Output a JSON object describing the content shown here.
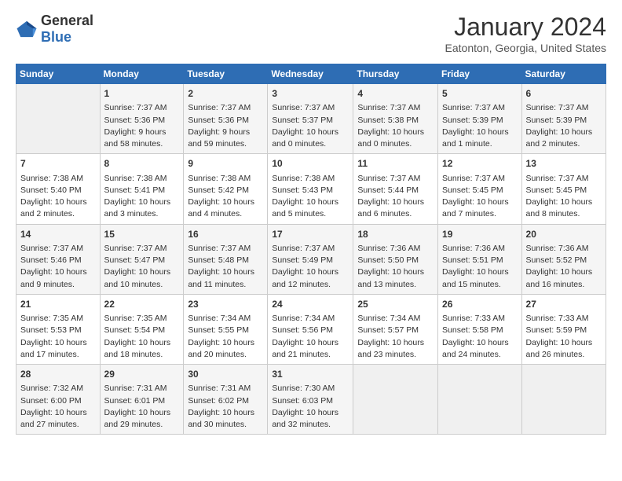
{
  "logo": {
    "general": "General",
    "blue": "Blue"
  },
  "title": "January 2024",
  "subtitle": "Eatonton, Georgia, United States",
  "headers": [
    "Sunday",
    "Monday",
    "Tuesday",
    "Wednesday",
    "Thursday",
    "Friday",
    "Saturday"
  ],
  "weeks": [
    [
      {
        "day": "",
        "sunrise": "",
        "sunset": "",
        "daylight": ""
      },
      {
        "day": "1",
        "sunrise": "Sunrise: 7:37 AM",
        "sunset": "Sunset: 5:36 PM",
        "daylight": "Daylight: 9 hours and 58 minutes."
      },
      {
        "day": "2",
        "sunrise": "Sunrise: 7:37 AM",
        "sunset": "Sunset: 5:36 PM",
        "daylight": "Daylight: 9 hours and 59 minutes."
      },
      {
        "day": "3",
        "sunrise": "Sunrise: 7:37 AM",
        "sunset": "Sunset: 5:37 PM",
        "daylight": "Daylight: 10 hours and 0 minutes."
      },
      {
        "day": "4",
        "sunrise": "Sunrise: 7:37 AM",
        "sunset": "Sunset: 5:38 PM",
        "daylight": "Daylight: 10 hours and 0 minutes."
      },
      {
        "day": "5",
        "sunrise": "Sunrise: 7:37 AM",
        "sunset": "Sunset: 5:39 PM",
        "daylight": "Daylight: 10 hours and 1 minute."
      },
      {
        "day": "6",
        "sunrise": "Sunrise: 7:37 AM",
        "sunset": "Sunset: 5:39 PM",
        "daylight": "Daylight: 10 hours and 2 minutes."
      }
    ],
    [
      {
        "day": "7",
        "sunrise": "Sunrise: 7:38 AM",
        "sunset": "Sunset: 5:40 PM",
        "daylight": "Daylight: 10 hours and 2 minutes."
      },
      {
        "day": "8",
        "sunrise": "Sunrise: 7:38 AM",
        "sunset": "Sunset: 5:41 PM",
        "daylight": "Daylight: 10 hours and 3 minutes."
      },
      {
        "day": "9",
        "sunrise": "Sunrise: 7:38 AM",
        "sunset": "Sunset: 5:42 PM",
        "daylight": "Daylight: 10 hours and 4 minutes."
      },
      {
        "day": "10",
        "sunrise": "Sunrise: 7:38 AM",
        "sunset": "Sunset: 5:43 PM",
        "daylight": "Daylight: 10 hours and 5 minutes."
      },
      {
        "day": "11",
        "sunrise": "Sunrise: 7:37 AM",
        "sunset": "Sunset: 5:44 PM",
        "daylight": "Daylight: 10 hours and 6 minutes."
      },
      {
        "day": "12",
        "sunrise": "Sunrise: 7:37 AM",
        "sunset": "Sunset: 5:45 PM",
        "daylight": "Daylight: 10 hours and 7 minutes."
      },
      {
        "day": "13",
        "sunrise": "Sunrise: 7:37 AM",
        "sunset": "Sunset: 5:45 PM",
        "daylight": "Daylight: 10 hours and 8 minutes."
      }
    ],
    [
      {
        "day": "14",
        "sunrise": "Sunrise: 7:37 AM",
        "sunset": "Sunset: 5:46 PM",
        "daylight": "Daylight: 10 hours and 9 minutes."
      },
      {
        "day": "15",
        "sunrise": "Sunrise: 7:37 AM",
        "sunset": "Sunset: 5:47 PM",
        "daylight": "Daylight: 10 hours and 10 minutes."
      },
      {
        "day": "16",
        "sunrise": "Sunrise: 7:37 AM",
        "sunset": "Sunset: 5:48 PM",
        "daylight": "Daylight: 10 hours and 11 minutes."
      },
      {
        "day": "17",
        "sunrise": "Sunrise: 7:37 AM",
        "sunset": "Sunset: 5:49 PM",
        "daylight": "Daylight: 10 hours and 12 minutes."
      },
      {
        "day": "18",
        "sunrise": "Sunrise: 7:36 AM",
        "sunset": "Sunset: 5:50 PM",
        "daylight": "Daylight: 10 hours and 13 minutes."
      },
      {
        "day": "19",
        "sunrise": "Sunrise: 7:36 AM",
        "sunset": "Sunset: 5:51 PM",
        "daylight": "Daylight: 10 hours and 15 minutes."
      },
      {
        "day": "20",
        "sunrise": "Sunrise: 7:36 AM",
        "sunset": "Sunset: 5:52 PM",
        "daylight": "Daylight: 10 hours and 16 minutes."
      }
    ],
    [
      {
        "day": "21",
        "sunrise": "Sunrise: 7:35 AM",
        "sunset": "Sunset: 5:53 PM",
        "daylight": "Daylight: 10 hours and 17 minutes."
      },
      {
        "day": "22",
        "sunrise": "Sunrise: 7:35 AM",
        "sunset": "Sunset: 5:54 PM",
        "daylight": "Daylight: 10 hours and 18 minutes."
      },
      {
        "day": "23",
        "sunrise": "Sunrise: 7:34 AM",
        "sunset": "Sunset: 5:55 PM",
        "daylight": "Daylight: 10 hours and 20 minutes."
      },
      {
        "day": "24",
        "sunrise": "Sunrise: 7:34 AM",
        "sunset": "Sunset: 5:56 PM",
        "daylight": "Daylight: 10 hours and 21 minutes."
      },
      {
        "day": "25",
        "sunrise": "Sunrise: 7:34 AM",
        "sunset": "Sunset: 5:57 PM",
        "daylight": "Daylight: 10 hours and 23 minutes."
      },
      {
        "day": "26",
        "sunrise": "Sunrise: 7:33 AM",
        "sunset": "Sunset: 5:58 PM",
        "daylight": "Daylight: 10 hours and 24 minutes."
      },
      {
        "day": "27",
        "sunrise": "Sunrise: 7:33 AM",
        "sunset": "Sunset: 5:59 PM",
        "daylight": "Daylight: 10 hours and 26 minutes."
      }
    ],
    [
      {
        "day": "28",
        "sunrise": "Sunrise: 7:32 AM",
        "sunset": "Sunset: 6:00 PM",
        "daylight": "Daylight: 10 hours and 27 minutes."
      },
      {
        "day": "29",
        "sunrise": "Sunrise: 7:31 AM",
        "sunset": "Sunset: 6:01 PM",
        "daylight": "Daylight: 10 hours and 29 minutes."
      },
      {
        "day": "30",
        "sunrise": "Sunrise: 7:31 AM",
        "sunset": "Sunset: 6:02 PM",
        "daylight": "Daylight: 10 hours and 30 minutes."
      },
      {
        "day": "31",
        "sunrise": "Sunrise: 7:30 AM",
        "sunset": "Sunset: 6:03 PM",
        "daylight": "Daylight: 10 hours and 32 minutes."
      },
      {
        "day": "",
        "sunrise": "",
        "sunset": "",
        "daylight": ""
      },
      {
        "day": "",
        "sunrise": "",
        "sunset": "",
        "daylight": ""
      },
      {
        "day": "",
        "sunrise": "",
        "sunset": "",
        "daylight": ""
      }
    ]
  ]
}
